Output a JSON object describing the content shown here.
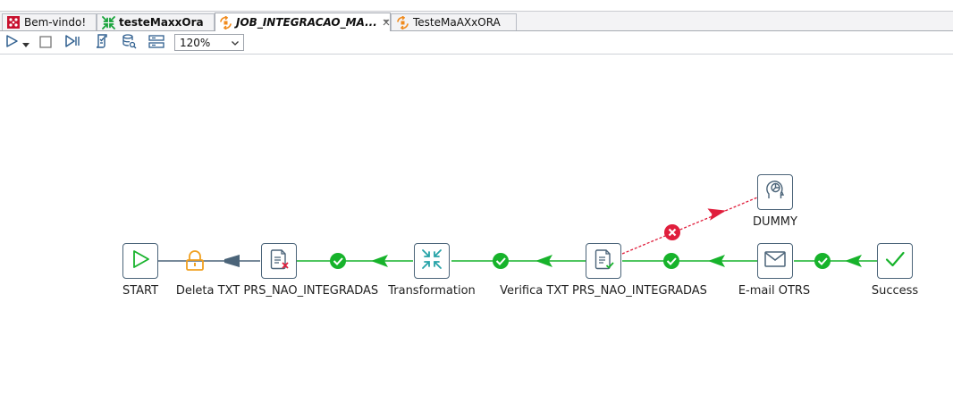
{
  "tabs": [
    {
      "label": "Bem-vindo!",
      "icon": "welcome-icon",
      "style": "normal"
    },
    {
      "label": "testeMaxxOra",
      "icon": "transformation-icon",
      "style": "bold"
    },
    {
      "label": "JOB_INTEGRACAO_MA...",
      "icon": "job-icon",
      "style": "bold-italic",
      "active": true
    },
    {
      "label": "TesteMaAXxORA",
      "icon": "job-icon",
      "style": "normal"
    }
  ],
  "toolbar": {
    "zoom_value": "120%",
    "buttons": [
      "run-icon",
      "run-dropdown-icon",
      "stop-icon",
      "replay-icon",
      "verify-icon",
      "sql-icon",
      "explore-db-icon"
    ]
  },
  "nodes": {
    "start": "START",
    "delete": "Deleta TXT PRS_NAO_INTEGRADAS",
    "transformation": "Transformation",
    "verify": "Verifica TXT PRS_NAO_INTEGRADAS",
    "email": "E-mail OTRS",
    "success": "Success",
    "dummy": "DUMMY"
  },
  "colors": {
    "ok": "#17b32b",
    "error": "#e01e3c",
    "unconditional": "#4b6479",
    "lock": "#f0a020",
    "node_border": "#4b6479",
    "icon_teal": "#27a3a8"
  }
}
